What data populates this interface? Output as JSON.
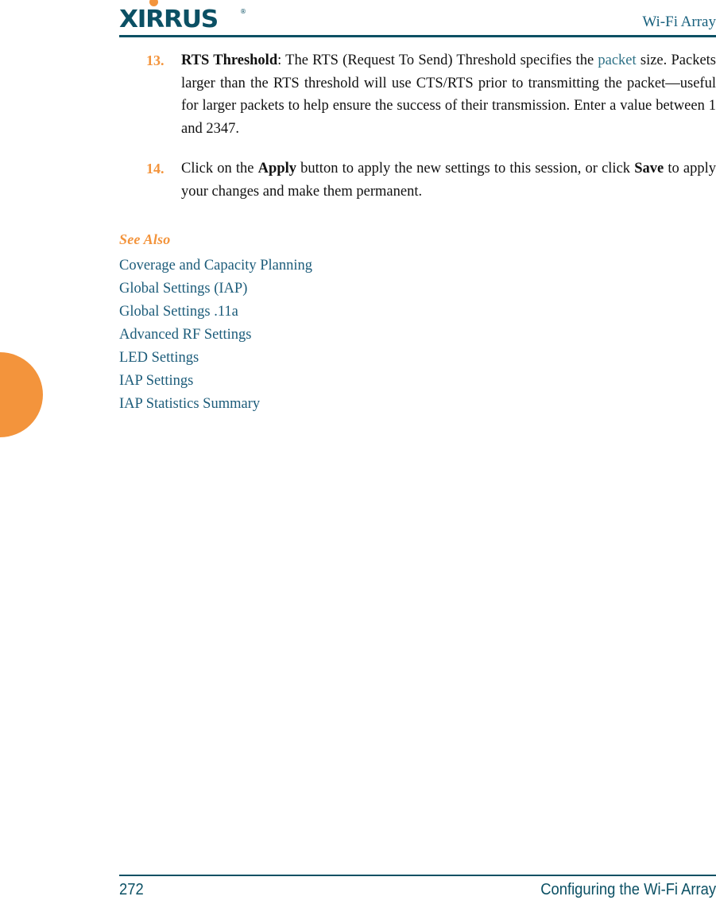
{
  "header": {
    "logo_text": "XIRRUS",
    "logo_registered_mark": "®",
    "logo_dot_icon": "orange-dot-icon",
    "title": "Wi-Fi Array",
    "rule_color": "#0B5064",
    "logo_color": "#0B5064",
    "accent_color": "#F3943C"
  },
  "body": {
    "items": [
      {
        "number": "13.",
        "term": "RTS Threshold",
        "text_before_link": ": The RTS (Request To Send) Threshold specifies the ",
        "link_text": "packet",
        "text_after_link": " size. Packets larger than the RTS threshold will use CTS/RTS prior to transmitting the packet—useful for larger packets to help ensure the success of their transmission. Enter a value between 1 and 2347."
      },
      {
        "number": "14.",
        "segment_1": "Click on the ",
        "bold_1": "Apply",
        "segment_2": " button to apply the new settings to this session, or click ",
        "bold_2": "Save",
        "segment_3": " to apply your changes and make them permanent."
      }
    ]
  },
  "see_also": {
    "title": "See Also",
    "links": [
      "Coverage and Capacity Planning",
      "Global Settings (IAP)",
      "Global Settings .11a",
      "Advanced RF Settings",
      "LED Settings",
      "IAP Settings",
      "IAP Statistics Summary"
    ],
    "title_color": "#F3943C",
    "link_color": "#1C5C7A"
  },
  "footer": {
    "page_number": "272",
    "label": "Configuring the Wi-Fi Array",
    "color": "#0B5064"
  },
  "decorations": {
    "left_tab_color": "#F3943C",
    "left_tab_name": "orange-margin-tab"
  }
}
